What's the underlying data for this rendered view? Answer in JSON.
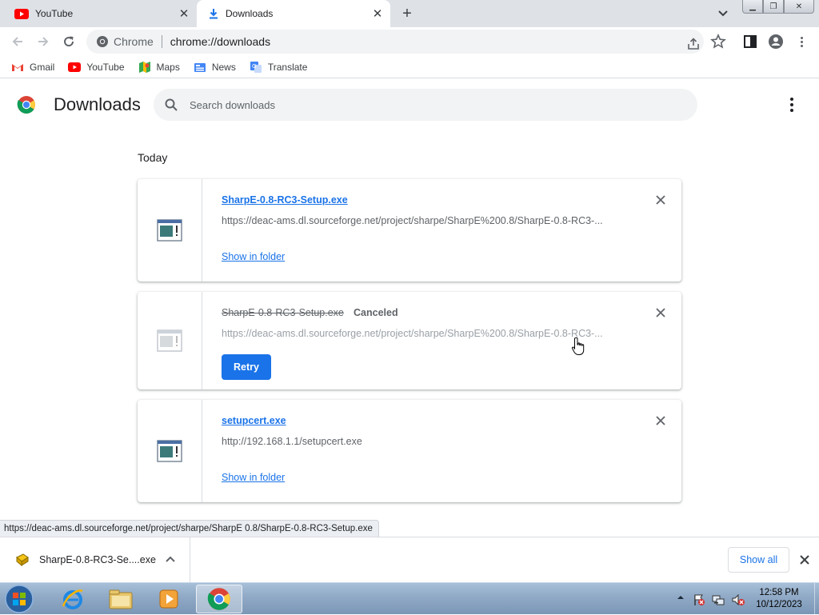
{
  "tabs": [
    {
      "title": "YouTube",
      "icon": "youtube-icon"
    },
    {
      "title": "Downloads",
      "icon": "download-icon",
      "active": true
    }
  ],
  "omnibox": {
    "chip": "Chrome",
    "url": "chrome://downloads"
  },
  "bookmarks": [
    {
      "label": "Gmail",
      "icon": "gmail-icon"
    },
    {
      "label": "YouTube",
      "icon": "youtube-icon"
    },
    {
      "label": "Maps",
      "icon": "maps-icon"
    },
    {
      "label": "News",
      "icon": "news-icon"
    },
    {
      "label": "Translate",
      "icon": "translate-icon"
    }
  ],
  "page": {
    "title": "Downloads",
    "search_placeholder": "Search downloads",
    "date_header": "Today"
  },
  "downloads": [
    {
      "name": "SharpE-0.8-RC3-Setup.exe",
      "url": "https://deac-ams.dl.sourceforge.net/project/sharpe/SharpE%200.8/SharpE-0.8-RC3-...",
      "action": "Show in folder",
      "state": "complete"
    },
    {
      "name": "SharpE-0.8-RC3-Setup.exe",
      "status": "Canceled",
      "url": "https://deac-ams.dl.sourceforge.net/project/sharpe/SharpE%200.8/SharpE-0.8-RC3-...",
      "action": "Retry",
      "state": "canceled"
    },
    {
      "name": "setupcert.exe",
      "url": "http://192.168.1.1/setupcert.exe",
      "action": "Show in folder",
      "state": "complete"
    }
  ],
  "status_bubble": "https://deac-ams.dl.sourceforge.net/project/sharpe/SharpE 0.8/SharpE-0.8-RC3-Setup.exe",
  "shelf": {
    "item_name": "SharpE-0.8-RC3-Se....exe",
    "show_all": "Show all"
  },
  "taskbar": {
    "time": "12:58 PM",
    "date": "10/12/2023",
    "apps": [
      "ie-icon",
      "explorer-icon",
      "media-player-icon",
      "chrome-icon"
    ]
  },
  "colors": {
    "accent": "#1a73e8",
    "tabstrip": "#dee1e6"
  }
}
